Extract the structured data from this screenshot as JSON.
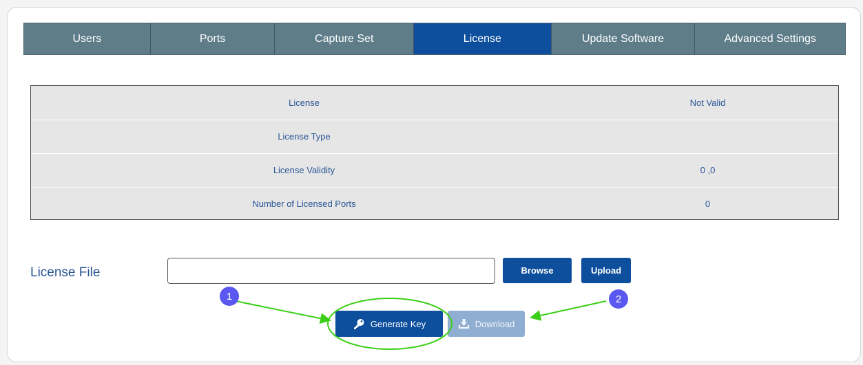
{
  "tabs": [
    {
      "label": "Users",
      "active": false
    },
    {
      "label": "Ports",
      "active": false
    },
    {
      "label": "Capture Set",
      "active": false
    },
    {
      "label": "License",
      "active": true
    },
    {
      "label": "Update Software",
      "active": false
    },
    {
      "label": "Advanced Settings",
      "active": false
    }
  ],
  "license_table": [
    {
      "label": "License",
      "value": "Not Valid"
    },
    {
      "label": "License Type",
      "value": ""
    },
    {
      "label": "License Validity",
      "value": "0 ,0"
    },
    {
      "label": "Number of Licensed Ports",
      "value": "0"
    }
  ],
  "license_file": {
    "label": "License File",
    "value": "",
    "placeholder": "",
    "browse_label": "Browse",
    "upload_label": "Upload"
  },
  "actions": {
    "generate_key_label": "Generate Key",
    "generate_key_icon": "key-icon",
    "download_label": "Download",
    "download_icon": "download-icon",
    "download_enabled": false
  },
  "annotations": {
    "step_1": "1",
    "step_2": "2",
    "badge_color": "#5a58f0",
    "arrow_color": "#3bcf17"
  },
  "colors": {
    "tab_bg": "#5e7d89",
    "tab_active_bg": "#0d4e9d",
    "primary_button": "#0d4e9d",
    "disabled_button": "#90aed2",
    "text_blue": "#2a5596",
    "table_bg": "#e6e6e6"
  }
}
